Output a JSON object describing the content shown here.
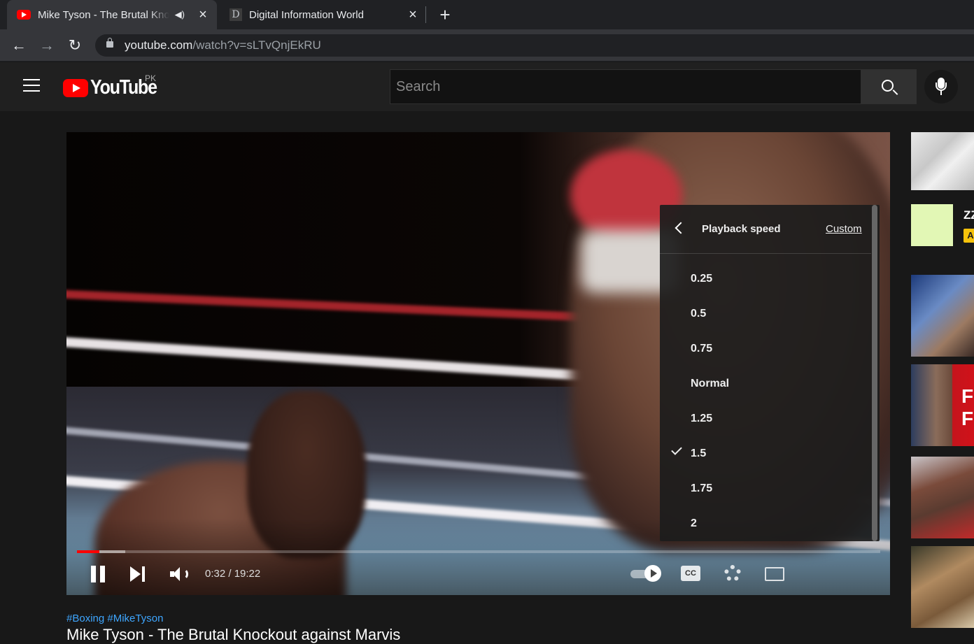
{
  "browser": {
    "tabs": [
      {
        "title": "Mike Tyson - The Brutal Knockout against Marvis",
        "active": true,
        "audio_icon": "speaker-icon"
      },
      {
        "title": "Digital Information World",
        "active": false,
        "favicon_letter": "D"
      }
    ],
    "new_tab_icon": "plus-icon",
    "url_host": "youtube.com",
    "url_path": "/watch?v=sLTvQnjEkRU"
  },
  "masthead": {
    "logo_text": "YouTube",
    "country_code": "PK",
    "search_placeholder": "Search"
  },
  "player": {
    "current_time": "0:32",
    "duration": "19:22",
    "time_display": "0:32 / 19:22",
    "progress_fraction": 0.028,
    "buffered_fraction": 0.06,
    "cc_label": "CC"
  },
  "speed_menu": {
    "title": "Playback speed",
    "custom_label": "Custom",
    "options": [
      "0.25",
      "0.5",
      "0.75",
      "Normal",
      "1.25",
      "1.5",
      "1.75",
      "2"
    ],
    "selected": "1.5"
  },
  "video": {
    "hashtags": "#Boxing #MikeTyson",
    "title": "Mike Tyson - The Brutal Knockout against Marvis"
  },
  "sidebar": {
    "ad_title": "ZZ",
    "ad_badge": "A",
    "thumb2_text": "FI FI"
  },
  "colors": {
    "youtube_red": "#ff0000",
    "link_blue": "#3ea6ff",
    "ad_badge_yellow": "#f6c20b"
  }
}
